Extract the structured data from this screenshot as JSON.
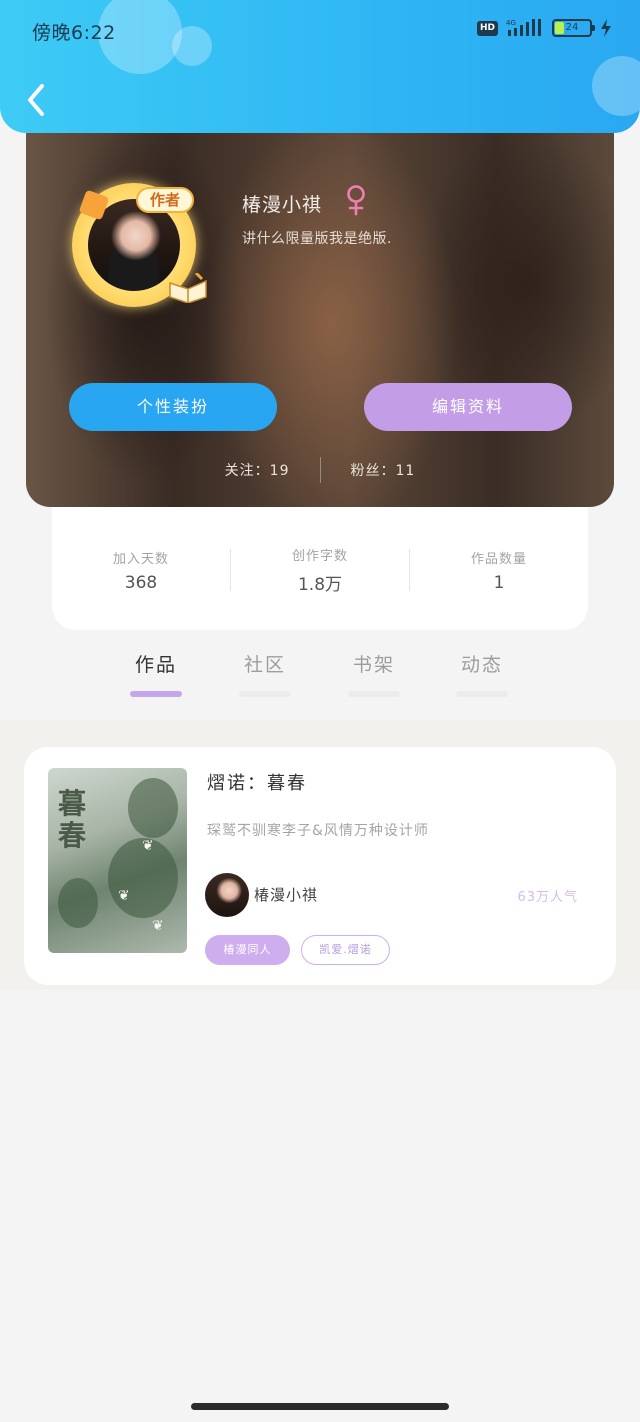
{
  "status_bar": {
    "time": "傍晚6:22",
    "hd": "HD",
    "network": "4G",
    "battery": "24"
  },
  "profile": {
    "name": "椿漫小祺",
    "bio": "讲什么限量版我是绝版.",
    "badge": "作者",
    "follow_label": "关注：19",
    "fans_label": "粉丝：11",
    "decorate_button": "个性装扮",
    "edit_button": "编辑资料"
  },
  "stats": [
    {
      "label": "加入天数",
      "value": "368"
    },
    {
      "label": "创作字数",
      "value": "1.8万"
    },
    {
      "label": "作品数量",
      "value": "1"
    }
  ],
  "tabs": [
    {
      "label": "作品",
      "active": true
    },
    {
      "label": "社区",
      "active": false
    },
    {
      "label": "书架",
      "active": false
    },
    {
      "label": "动态",
      "active": false
    }
  ],
  "work": {
    "title": "熠诺：暮春",
    "cover_title": "暮\n春",
    "description": "琛鹫不驯寒李子&风情万种设计师",
    "author": "椿漫小祺",
    "popularity": "63万人气",
    "tags": [
      "椿漫同人",
      "凯爱.熠诺"
    ]
  },
  "colors": {
    "header": "#2eb6f4",
    "accent_blue": "#29a6f2",
    "accent_purple": "#c39ee6",
    "tab_active": "#c6a6ea"
  }
}
